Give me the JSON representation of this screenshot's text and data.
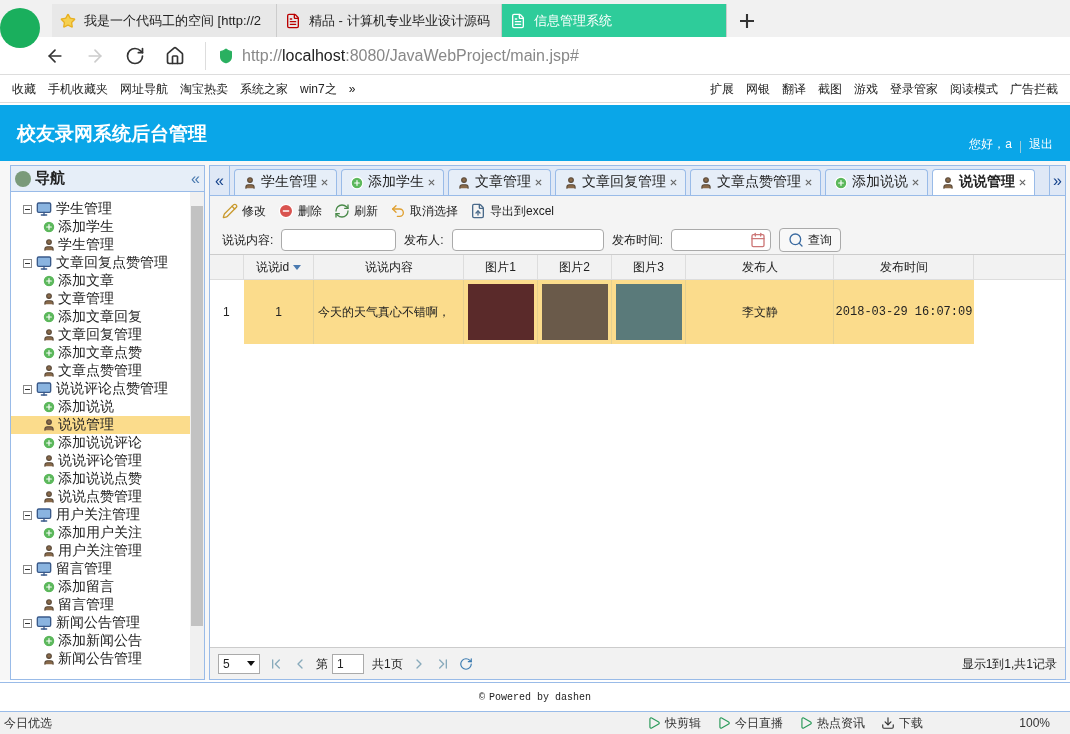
{
  "browser": {
    "tabs": [
      {
        "title": "我是一个代码工的空间 [http://2",
        "selected": false
      },
      {
        "title": "精品 - 计算机专业毕业设计源码",
        "selected": false
      },
      {
        "title": "信息管理系统",
        "selected": true
      }
    ],
    "url_host": "localhost",
    "url_prefix": "http://",
    "url_rest": ":8080/JavaWebProject/main.jsp#",
    "bookmarks": [
      "收藏",
      "手机收藏夹",
      "网址导航",
      "淘宝热卖",
      "系统之家",
      "win7之",
      "»"
    ],
    "extensions": [
      "扩展",
      "网银",
      "翻译",
      "截图",
      "游戏",
      "登录管家",
      "阅读模式",
      "广告拦截"
    ]
  },
  "header": {
    "title": "校友录网系统后台管理",
    "greeting": "您好，a",
    "logout": "退出"
  },
  "sidebar": {
    "title": "导航",
    "collapse": "«",
    "groups": [
      {
        "label": "学生管理",
        "expanded": true,
        "children": [
          {
            "label": "添加学生",
            "kind": "add",
            "selected": false
          },
          {
            "label": "学生管理",
            "kind": "manage",
            "selected": false
          }
        ]
      },
      {
        "label": "文章回复点赞管理",
        "expanded": true,
        "children": [
          {
            "label": "添加文章",
            "kind": "add",
            "selected": false
          },
          {
            "label": "文章管理",
            "kind": "manage",
            "selected": false
          },
          {
            "label": "添加文章回复",
            "kind": "add",
            "selected": false
          },
          {
            "label": "文章回复管理",
            "kind": "manage",
            "selected": false
          },
          {
            "label": "添加文章点赞",
            "kind": "add",
            "selected": false
          },
          {
            "label": "文章点赞管理",
            "kind": "manage",
            "selected": false
          }
        ]
      },
      {
        "label": "说说评论点赞管理",
        "expanded": true,
        "children": [
          {
            "label": "添加说说",
            "kind": "add",
            "selected": false
          },
          {
            "label": "说说管理",
            "kind": "manage",
            "selected": true
          },
          {
            "label": "添加说说评论",
            "kind": "add",
            "selected": false
          },
          {
            "label": "说说评论管理",
            "kind": "manage",
            "selected": false
          },
          {
            "label": "添加说说点赞",
            "kind": "add",
            "selected": false
          },
          {
            "label": "说说点赞管理",
            "kind": "manage",
            "selected": false
          }
        ]
      },
      {
        "label": "用户关注管理",
        "expanded": true,
        "children": [
          {
            "label": "添加用户关注",
            "kind": "add",
            "selected": false
          },
          {
            "label": "用户关注管理",
            "kind": "manage",
            "selected": false
          }
        ]
      },
      {
        "label": "留言管理",
        "expanded": true,
        "children": [
          {
            "label": "添加留言",
            "kind": "add",
            "selected": false
          },
          {
            "label": "留言管理",
            "kind": "manage",
            "selected": false
          }
        ]
      },
      {
        "label": "新闻公告管理",
        "expanded": true,
        "children": [
          {
            "label": "添加新闻公告",
            "kind": "add",
            "selected": false
          },
          {
            "label": "新闻公告管理",
            "kind": "manage",
            "selected": false
          }
        ]
      }
    ]
  },
  "tabs": {
    "prev": "«",
    "next": "»",
    "items": [
      {
        "label": "学生管理",
        "kind": "manage",
        "selected": false
      },
      {
        "label": "添加学生",
        "kind": "add",
        "selected": false
      },
      {
        "label": "文章管理",
        "kind": "manage",
        "selected": false
      },
      {
        "label": "文章回复管理",
        "kind": "manage",
        "selected": false
      },
      {
        "label": "文章点赞管理",
        "kind": "manage",
        "selected": false
      },
      {
        "label": "添加说说",
        "kind": "add",
        "selected": false
      },
      {
        "label": "说说管理",
        "kind": "manage",
        "selected": true
      }
    ]
  },
  "toolbar": [
    {
      "label": "修改",
      "kind": "edit"
    },
    {
      "label": "删除",
      "kind": "delete"
    },
    {
      "label": "刷新",
      "kind": "refresh"
    },
    {
      "label": "取消选择",
      "kind": "undo"
    },
    {
      "label": "导出到excel",
      "kind": "export"
    }
  ],
  "search": {
    "content_label": "说说内容:",
    "author_label": "发布人:",
    "time_label": "发布时间:",
    "button": "查询"
  },
  "table": {
    "columns": [
      "说说id",
      "说说内容",
      "图片1",
      "图片2",
      "图片3",
      "发布人",
      "发布时间"
    ],
    "rows": [
      {
        "index": "1",
        "id": "1",
        "content": "今天的天气真心不错啊，",
        "author": "李文静",
        "time": "2018-03-29 16:07:09",
        "selected": true
      }
    ]
  },
  "pager": {
    "page_size": "5",
    "page_prefix": "第",
    "page": "1",
    "page_total": "共1页",
    "summary": "显示1到1,共1记录"
  },
  "footer": {
    "mark": "©",
    "text": "Powered by dashen"
  },
  "status_bar": {
    "left": "今日优选",
    "items": [
      "快剪辑",
      "今日直播",
      "热点资讯",
      "下载"
    ],
    "zoom": "100%"
  }
}
